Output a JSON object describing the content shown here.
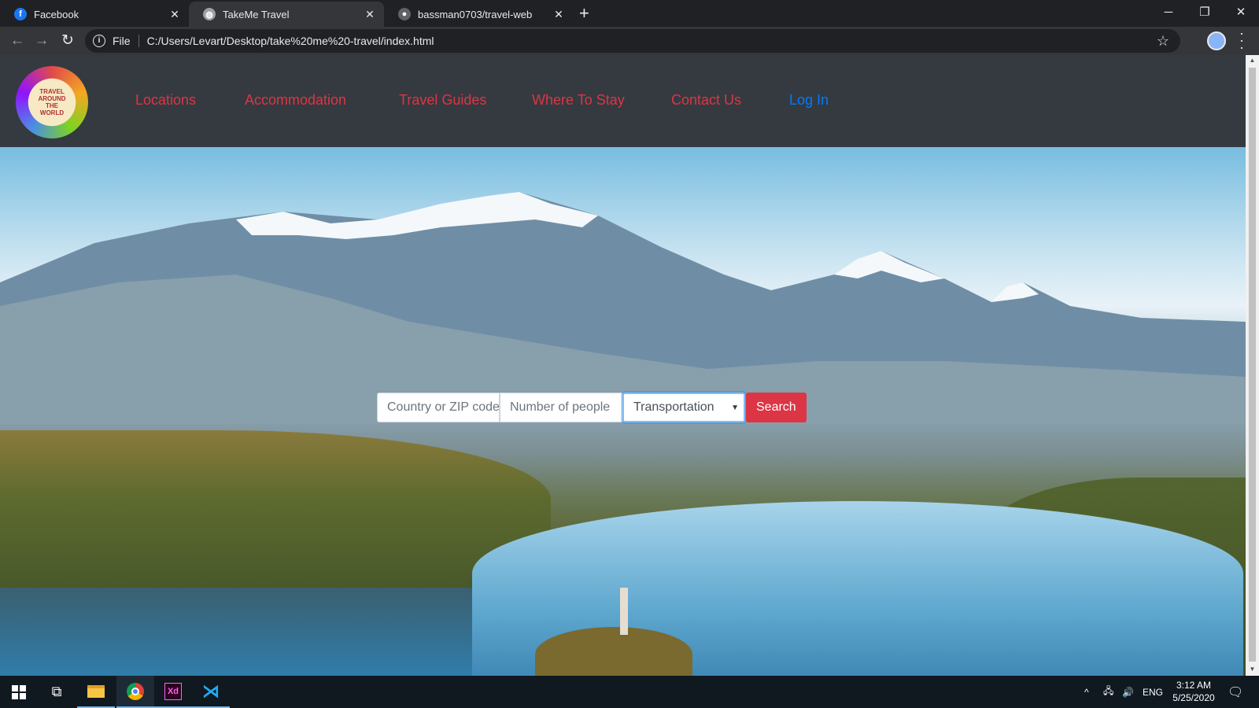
{
  "browser": {
    "tabs": [
      {
        "title": "Facebook",
        "icon": "facebook-icon",
        "color": "#1877f2"
      },
      {
        "title": "TakeMe Travel",
        "icon": "globe-icon",
        "color": "#9aa0a6"
      },
      {
        "title": "bassman0703/travel-web",
        "icon": "github-icon",
        "color": "#5f6368"
      }
    ],
    "omnibox": {
      "scheme": "File",
      "url": "C:/Users/Levart/Desktop/take%20me%20-travel/index.html"
    }
  },
  "site": {
    "logo_text": "TRAVEL AROUND THE WORLD",
    "nav": [
      "Locations",
      "Accommodation",
      "Travel Guides",
      "Where To Stay",
      "Contact Us",
      "Log In"
    ],
    "colors": {
      "nav_bg": "#343a40",
      "link": "#dc3545",
      "login": "#007bff",
      "button": "#dc3545"
    },
    "search": {
      "country_placeholder": "Country or ZIP code",
      "people_placeholder": "Number of people",
      "select_value": "Transportation",
      "button_label": "Search"
    }
  },
  "taskbar": {
    "language": "ENG",
    "time": "3:12 AM",
    "date": "5/25/2020"
  }
}
